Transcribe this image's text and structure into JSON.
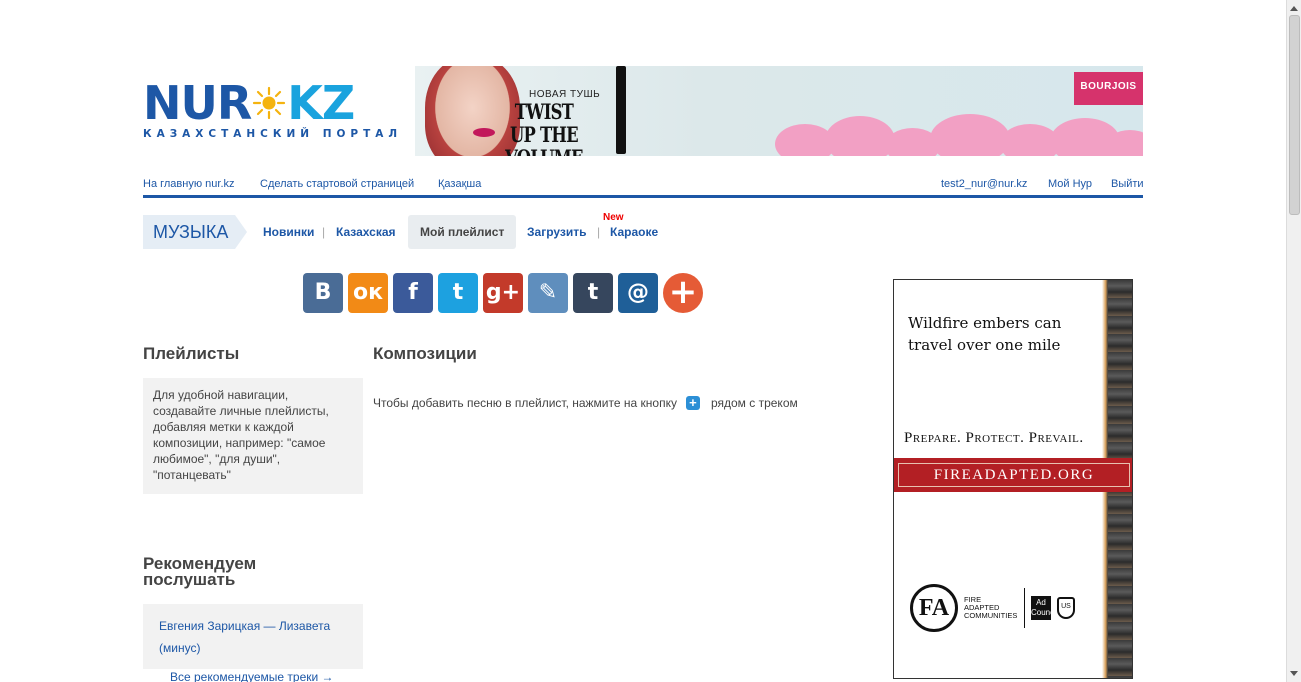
{
  "header": {
    "logo_left": "NUR",
    "logo_right": "KZ",
    "logo_tagline": "КАЗАХСТАНСКИЙ ПОРТАЛ"
  },
  "banner": {
    "small_text": "НОВАЯ ТУШЬ",
    "headline": "TWIST UP THE VOLUME",
    "brand": "BOURJOIS"
  },
  "topnav": {
    "home": "На главную nur.kz",
    "start_page": "Сделать стартовой страницей",
    "kazakh": "Қазақша",
    "email": "test2_nur@nur.kz",
    "my_nur": "Мой Нур",
    "logout": "Выйти"
  },
  "section": {
    "title": "МУЗЫКА",
    "items": [
      {
        "label": "Новинки"
      },
      {
        "label": "Казахская"
      },
      {
        "label": "Мой плейлист"
      },
      {
        "label": "Загрузить"
      },
      {
        "label": "Караоке"
      }
    ],
    "separator": "|",
    "new_badge": "New"
  },
  "share": {
    "icons": [
      "vk-icon",
      "odnoklassniki-icon",
      "facebook-icon",
      "twitter-icon",
      "google-plus-icon",
      "livejournal-icon",
      "tumblr-icon",
      "mailru-icon",
      "more-plus-icon"
    ],
    "glyphs": [
      "В",
      "ок",
      "f",
      "t",
      "g+",
      "✎",
      "t",
      "@",
      "+"
    ],
    "colors": [
      "#4a6c96",
      "#f28a16",
      "#3b5a9a",
      "#1da1e0",
      "#c33a2a",
      "#5f8ebd",
      "#36465d",
      "#1f5f98",
      "#e55b36"
    ]
  },
  "left": {
    "playlists_title": "Плейлисты",
    "playlists_info": "Для удобной навигации, создавайте личные плейлисты, добавляя метки к каждой композиции, например: \"самое любимое\", \"для души\", \"потанцевать\"",
    "recommend_title": "Рекомендуем послушать",
    "recommend_track": "Евгения Зарицкая — Лизавета (минус)",
    "recommend_all": "Все рекомендуемые треки →"
  },
  "main": {
    "title": "Композиции",
    "hint_before": "Чтобы добавить песню в плейлист, нажмите на кнопку",
    "hint_after": "рядом с треком"
  },
  "side_ad": {
    "line1": "Wildfire embers can travel over one mile",
    "line2": "Prepare. Protect. Prevail.",
    "band": "FIREADAPTED.ORG",
    "logo_mark": "FA",
    "logo_text": "FIRE ADAPTED COMMUNITIES",
    "ad_council": "Ad Council"
  }
}
